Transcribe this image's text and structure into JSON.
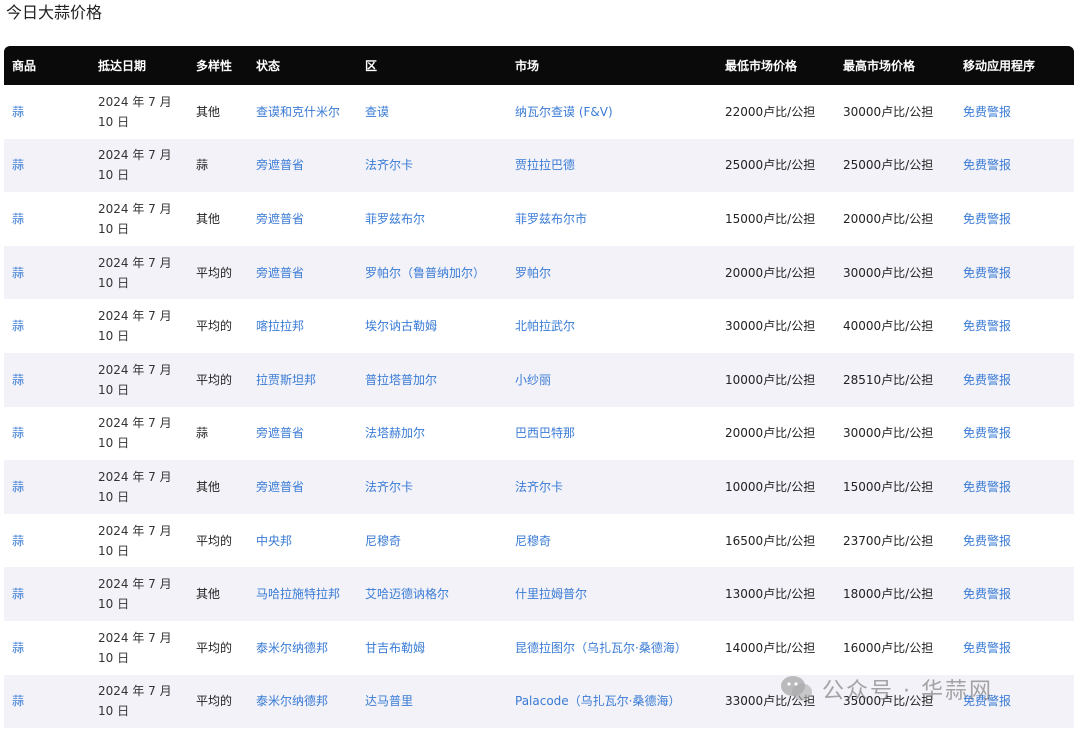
{
  "page": {
    "title": "今日大蒜价格"
  },
  "table": {
    "headers": [
      "商品",
      "抵达日期",
      "多样性",
      "状态",
      "区",
      "市场",
      "最低市场价格",
      "最高市场价格",
      "移动应用程序"
    ],
    "rows": [
      {
        "commodity": "蒜",
        "date": "2024 年 7 月 10 日",
        "variety": "其他",
        "state": "查谟和克什米尔",
        "district": "查谟",
        "market": "纳瓦尔查谟 (F&V)",
        "min": "22000卢比/公担",
        "max": "30000卢比/公担",
        "app": "免费警报"
      },
      {
        "commodity": "蒜",
        "date": "2024 年 7 月 10 日",
        "variety": "蒜",
        "state": "旁遮普省",
        "district": "法齐尔卡",
        "market": "贾拉拉巴德",
        "min": "25000卢比/公担",
        "max": "25000卢比/公担",
        "app": "免费警报"
      },
      {
        "commodity": "蒜",
        "date": "2024 年 7 月 10 日",
        "variety": "其他",
        "state": "旁遮普省",
        "district": "菲罗兹布尔",
        "market": "菲罗兹布尔市",
        "min": "15000卢比/公担",
        "max": "20000卢比/公担",
        "app": "免费警报"
      },
      {
        "commodity": "蒜",
        "date": "2024 年 7 月 10 日",
        "variety": "平均的",
        "state": "旁遮普省",
        "district": "罗帕尔（鲁普纳加尔）",
        "market": "罗帕尔",
        "min": "20000卢比/公担",
        "max": "30000卢比/公担",
        "app": "免费警报"
      },
      {
        "commodity": "蒜",
        "date": "2024 年 7 月 10 日",
        "variety": "平均的",
        "state": "喀拉拉邦",
        "district": "埃尔讷古勒姆",
        "market": "北帕拉武尔",
        "min": "30000卢比/公担",
        "max": "40000卢比/公担",
        "app": "免费警报"
      },
      {
        "commodity": "蒜",
        "date": "2024 年 7 月 10 日",
        "variety": "平均的",
        "state": "拉贾斯坦邦",
        "district": "普拉塔普加尔",
        "market": "小纱丽",
        "min": "10000卢比/公担",
        "max": "28510卢比/公担",
        "app": "免费警报"
      },
      {
        "commodity": "蒜",
        "date": "2024 年 7 月 10 日",
        "variety": "蒜",
        "state": "旁遮普省",
        "district": "法塔赫加尔",
        "market": "巴西巴特那",
        "min": "20000卢比/公担",
        "max": "30000卢比/公担",
        "app": "免费警报"
      },
      {
        "commodity": "蒜",
        "date": "2024 年 7 月 10 日",
        "variety": "其他",
        "state": "旁遮普省",
        "district": "法齐尔卡",
        "market": "法齐尔卡",
        "min": "10000卢比/公担",
        "max": "15000卢比/公担",
        "app": "免费警报"
      },
      {
        "commodity": "蒜",
        "date": "2024 年 7 月 10 日",
        "variety": "平均的",
        "state": "中央邦",
        "district": "尼穆奇",
        "market": "尼穆奇",
        "min": "16500卢比/公担",
        "max": "23700卢比/公担",
        "app": "免费警报"
      },
      {
        "commodity": "蒜",
        "date": "2024 年 7 月 10 日",
        "variety": "其他",
        "state": "马哈拉施特拉邦",
        "district": "艾哈迈德讷格尔",
        "market": "什里拉姆普尔",
        "min": "13000卢比/公担",
        "max": "18000卢比/公担",
        "app": "免费警报"
      },
      {
        "commodity": "蒜",
        "date": "2024 年 7 月 10 日",
        "variety": "平均的",
        "state": "泰米尔纳德邦",
        "district": "甘吉布勒姆",
        "market": "昆德拉图尔（乌扎瓦尔·桑德海）",
        "min": "14000卢比/公担",
        "max": "16000卢比/公担",
        "app": "免费警报"
      },
      {
        "commodity": "蒜",
        "date": "2024 年 7 月 10 日",
        "variety": "平均的",
        "state": "泰米尔纳德邦",
        "district": "达马普里",
        "market": "Palacode（乌扎瓦尔·桑德海）",
        "min": "33000卢比/公担",
        "max": "35000卢比/公担",
        "app": "免费警报"
      }
    ]
  },
  "watermark": {
    "text": "公众号 · 华蒜网",
    "icon": "wechat-icon"
  }
}
